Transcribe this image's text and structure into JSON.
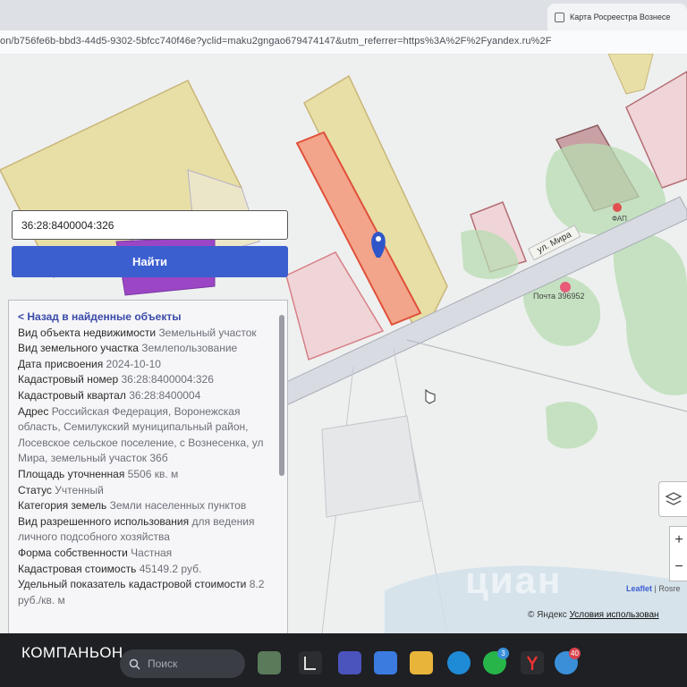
{
  "browser": {
    "tab_title": "Карта Росреестра Вознесе",
    "url": "on/b756fe6b-bbd3-44d5-9302-5bfcc740f46e?yclid=maku2gngao679474147&utm_referrer=https%3A%2F%2Fyandex.ru%2F"
  },
  "search": {
    "cadastral_value": "36:28:8400004:326",
    "find_label": "Найти"
  },
  "info": {
    "back_label": "< Назад в найденные объекты",
    "rows": [
      {
        "label": "Вид объекта недвижимости",
        "value": "Земельный участок"
      },
      {
        "label": "Вид земельного участка",
        "value": "Землепользование"
      },
      {
        "label": "Дата присвоения",
        "value": "2024-10-10"
      },
      {
        "label": "Кадастровый номер",
        "value": "36:28:8400004:326"
      },
      {
        "label": "Кадастровый квартал",
        "value": "36:28:8400004"
      },
      {
        "label": "Адрес",
        "value": "Российская Федерация, Воронежская область, Семилукский муниципальный район, Лосевское сельское поселение, с Вознесенка, ул Мира, земельный участок 36б"
      },
      {
        "label": "Площадь уточненная",
        "value": "5506 кв. м"
      },
      {
        "label": "Статус",
        "value": "Учтенный"
      },
      {
        "label": "Категория земель",
        "value": "Земли населенных пунктов"
      },
      {
        "label": "Вид разрешенного использования",
        "value": "для ведения личного подсобного хозяйства"
      },
      {
        "label": "Форма собственности",
        "value": "Частная"
      },
      {
        "label": "Кадастровая стоимость",
        "value": "45149.2 руб."
      },
      {
        "label": "Удельный показатель кадастровой стоимости",
        "value": "8.2 руб./кв. м"
      }
    ]
  },
  "map": {
    "street_label": "ул. Мира",
    "post_office_label": "Почта 396952",
    "fap_label": "ФАП",
    "zoom_in": "+",
    "zoom_out": "−",
    "leaflet_label": "Leaflet",
    "rosreestr_label": "Rosre",
    "yandex_label": "© Яндекс",
    "terms_label": "Условия использован",
    "watermark": "циан"
  },
  "taskbar": {
    "brand": "КОМПАНЬОН",
    "search_placeholder": "Поиск",
    "whatsapp_badge": "3",
    "chrome_badge": "40"
  },
  "colors": {
    "parcel_selected": "#f2a58a",
    "parcel_yellow": "#e7dfa6",
    "parcel_pink": "#efd5d8",
    "green_area": "#b7dcb2",
    "find_button": "#3c5fd0",
    "marker": "#2f56c8"
  }
}
